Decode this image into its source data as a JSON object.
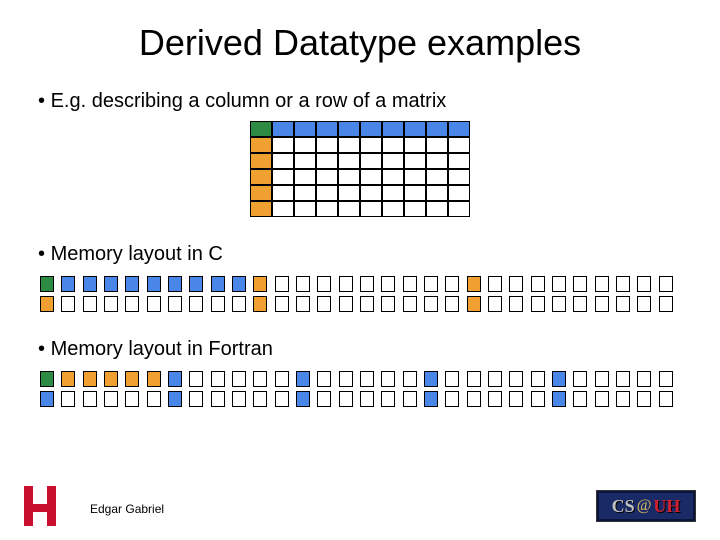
{
  "title": "Derived Datatype examples",
  "bullets": [
    "E.g. describing a column or a row of a matrix",
    "Memory layout in C",
    "Memory layout in Fortran"
  ],
  "author": "Edgar Gabriel",
  "matrix": {
    "rows": 6,
    "cols": 10,
    "green_cell": [
      0,
      0
    ],
    "blue_row": 0,
    "orange_col": 0
  },
  "c_layout": {
    "desc": "Row-major: first cell green, next 9 blue (row), then orange at index 0 of each subsequent row (every 10 cells).",
    "row_len": 10,
    "rows": 6,
    "cells_per_strip": 30
  },
  "fortran_layout": {
    "desc": "Column-major: first cell green, next 5 orange (column), then blue at index 0 of each subsequent column (every 6 cells).",
    "col_len": 6,
    "cols": 10,
    "cells_per_strip": 30
  },
  "badge": {
    "cs": "CS",
    "at": "@",
    "uh": "UH"
  },
  "colors": {
    "green": "#2e8b43",
    "blue": "#4a86e8",
    "orange": "#f0a030",
    "uh_red": "#c8102e",
    "badge_bg": "#1a2a66"
  }
}
